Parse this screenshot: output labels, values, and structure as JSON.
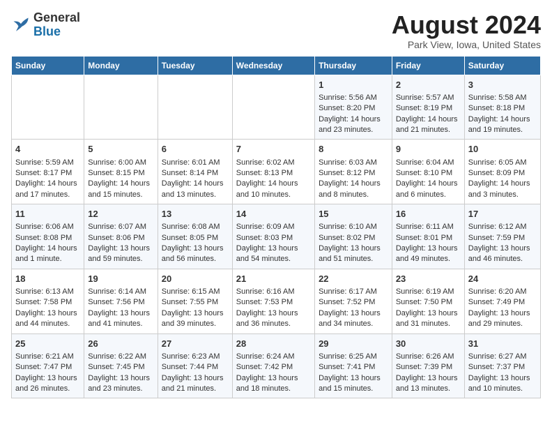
{
  "header": {
    "logo_line1": "General",
    "logo_line2": "Blue",
    "title": "August 2024",
    "subtitle": "Park View, Iowa, United States"
  },
  "days_of_week": [
    "Sunday",
    "Monday",
    "Tuesday",
    "Wednesday",
    "Thursday",
    "Friday",
    "Saturday"
  ],
  "weeks": [
    [
      {
        "day": "",
        "info": ""
      },
      {
        "day": "",
        "info": ""
      },
      {
        "day": "",
        "info": ""
      },
      {
        "day": "",
        "info": ""
      },
      {
        "day": "1",
        "info": "Sunrise: 5:56 AM\nSunset: 8:20 PM\nDaylight: 14 hours and 23 minutes."
      },
      {
        "day": "2",
        "info": "Sunrise: 5:57 AM\nSunset: 8:19 PM\nDaylight: 14 hours and 21 minutes."
      },
      {
        "day": "3",
        "info": "Sunrise: 5:58 AM\nSunset: 8:18 PM\nDaylight: 14 hours and 19 minutes."
      }
    ],
    [
      {
        "day": "4",
        "info": "Sunrise: 5:59 AM\nSunset: 8:17 PM\nDaylight: 14 hours and 17 minutes."
      },
      {
        "day": "5",
        "info": "Sunrise: 6:00 AM\nSunset: 8:15 PM\nDaylight: 14 hours and 15 minutes."
      },
      {
        "day": "6",
        "info": "Sunrise: 6:01 AM\nSunset: 8:14 PM\nDaylight: 14 hours and 13 minutes."
      },
      {
        "day": "7",
        "info": "Sunrise: 6:02 AM\nSunset: 8:13 PM\nDaylight: 14 hours and 10 minutes."
      },
      {
        "day": "8",
        "info": "Sunrise: 6:03 AM\nSunset: 8:12 PM\nDaylight: 14 hours and 8 minutes."
      },
      {
        "day": "9",
        "info": "Sunrise: 6:04 AM\nSunset: 8:10 PM\nDaylight: 14 hours and 6 minutes."
      },
      {
        "day": "10",
        "info": "Sunrise: 6:05 AM\nSunset: 8:09 PM\nDaylight: 14 hours and 3 minutes."
      }
    ],
    [
      {
        "day": "11",
        "info": "Sunrise: 6:06 AM\nSunset: 8:08 PM\nDaylight: 14 hours and 1 minute."
      },
      {
        "day": "12",
        "info": "Sunrise: 6:07 AM\nSunset: 8:06 PM\nDaylight: 13 hours and 59 minutes."
      },
      {
        "day": "13",
        "info": "Sunrise: 6:08 AM\nSunset: 8:05 PM\nDaylight: 13 hours and 56 minutes."
      },
      {
        "day": "14",
        "info": "Sunrise: 6:09 AM\nSunset: 8:03 PM\nDaylight: 13 hours and 54 minutes."
      },
      {
        "day": "15",
        "info": "Sunrise: 6:10 AM\nSunset: 8:02 PM\nDaylight: 13 hours and 51 minutes."
      },
      {
        "day": "16",
        "info": "Sunrise: 6:11 AM\nSunset: 8:01 PM\nDaylight: 13 hours and 49 minutes."
      },
      {
        "day": "17",
        "info": "Sunrise: 6:12 AM\nSunset: 7:59 PM\nDaylight: 13 hours and 46 minutes."
      }
    ],
    [
      {
        "day": "18",
        "info": "Sunrise: 6:13 AM\nSunset: 7:58 PM\nDaylight: 13 hours and 44 minutes."
      },
      {
        "day": "19",
        "info": "Sunrise: 6:14 AM\nSunset: 7:56 PM\nDaylight: 13 hours and 41 minutes."
      },
      {
        "day": "20",
        "info": "Sunrise: 6:15 AM\nSunset: 7:55 PM\nDaylight: 13 hours and 39 minutes."
      },
      {
        "day": "21",
        "info": "Sunrise: 6:16 AM\nSunset: 7:53 PM\nDaylight: 13 hours and 36 minutes."
      },
      {
        "day": "22",
        "info": "Sunrise: 6:17 AM\nSunset: 7:52 PM\nDaylight: 13 hours and 34 minutes."
      },
      {
        "day": "23",
        "info": "Sunrise: 6:19 AM\nSunset: 7:50 PM\nDaylight: 13 hours and 31 minutes."
      },
      {
        "day": "24",
        "info": "Sunrise: 6:20 AM\nSunset: 7:49 PM\nDaylight: 13 hours and 29 minutes."
      }
    ],
    [
      {
        "day": "25",
        "info": "Sunrise: 6:21 AM\nSunset: 7:47 PM\nDaylight: 13 hours and 26 minutes."
      },
      {
        "day": "26",
        "info": "Sunrise: 6:22 AM\nSunset: 7:45 PM\nDaylight: 13 hours and 23 minutes."
      },
      {
        "day": "27",
        "info": "Sunrise: 6:23 AM\nSunset: 7:44 PM\nDaylight: 13 hours and 21 minutes."
      },
      {
        "day": "28",
        "info": "Sunrise: 6:24 AM\nSunset: 7:42 PM\nDaylight: 13 hours and 18 minutes."
      },
      {
        "day": "29",
        "info": "Sunrise: 6:25 AM\nSunset: 7:41 PM\nDaylight: 13 hours and 15 minutes."
      },
      {
        "day": "30",
        "info": "Sunrise: 6:26 AM\nSunset: 7:39 PM\nDaylight: 13 hours and 13 minutes."
      },
      {
        "day": "31",
        "info": "Sunrise: 6:27 AM\nSunset: 7:37 PM\nDaylight: 13 hours and 10 minutes."
      }
    ]
  ]
}
